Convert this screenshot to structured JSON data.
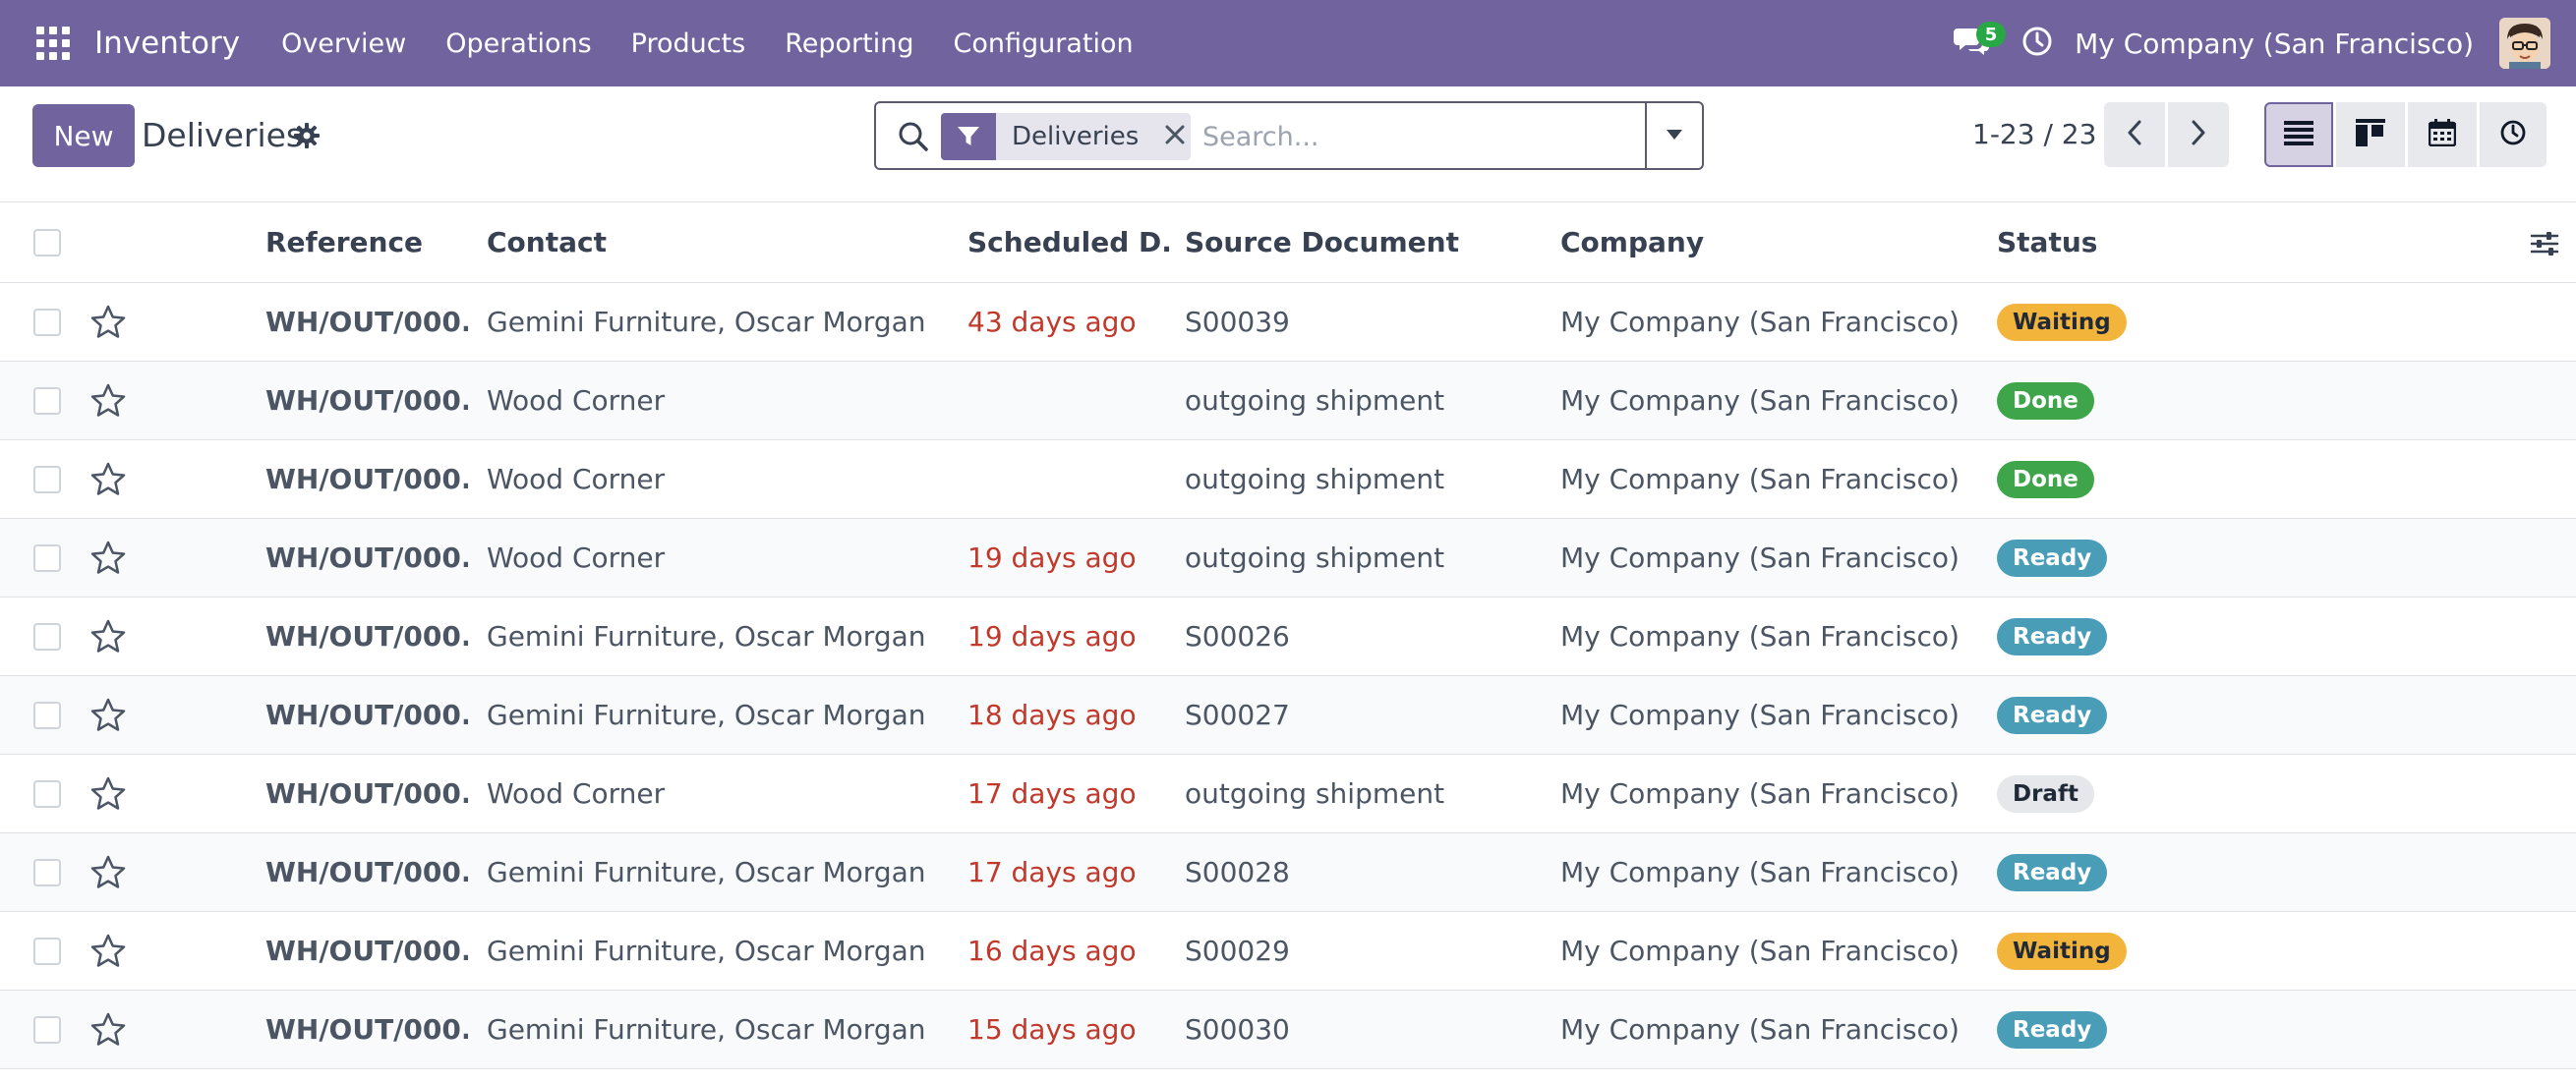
{
  "navbar": {
    "app_name": "Inventory",
    "menu": [
      "Overview",
      "Operations",
      "Products",
      "Reporting",
      "Configuration"
    ],
    "messages_count": "5",
    "company": "My Company (San Francisco)"
  },
  "control_panel": {
    "new_label": "New",
    "title": "Deliveries",
    "search": {
      "facet_label": "Deliveries",
      "placeholder": "Search..."
    },
    "pager": "1-23 / 23"
  },
  "table": {
    "columns": [
      "Reference",
      "Contact",
      "Scheduled D...",
      "Source Document",
      "Company",
      "Status"
    ],
    "rows": [
      {
        "reference": "WH/OUT/000...",
        "contact": "Gemini Furniture, Oscar Morgan",
        "scheduled": "43 days ago",
        "source": "S00039",
        "company": "My Company (San Francisco)",
        "status": "Waiting"
      },
      {
        "reference": "WH/OUT/000...",
        "contact": "Wood Corner",
        "scheduled": "",
        "source": "outgoing shipment",
        "company": "My Company (San Francisco)",
        "status": "Done"
      },
      {
        "reference": "WH/OUT/000...",
        "contact": "Wood Corner",
        "scheduled": "",
        "source": "outgoing shipment",
        "company": "My Company (San Francisco)",
        "status": "Done"
      },
      {
        "reference": "WH/OUT/000...",
        "contact": "Wood Corner",
        "scheduled": "19 days ago",
        "source": "outgoing shipment",
        "company": "My Company (San Francisco)",
        "status": "Ready"
      },
      {
        "reference": "WH/OUT/000...",
        "contact": "Gemini Furniture, Oscar Morgan",
        "scheduled": "19 days ago",
        "source": "S00026",
        "company": "My Company (San Francisco)",
        "status": "Ready"
      },
      {
        "reference": "WH/OUT/000...",
        "contact": "Gemini Furniture, Oscar Morgan",
        "scheduled": "18 days ago",
        "source": "S00027",
        "company": "My Company (San Francisco)",
        "status": "Ready"
      },
      {
        "reference": "WH/OUT/000...",
        "contact": "Wood Corner",
        "scheduled": "17 days ago",
        "source": "outgoing shipment",
        "company": "My Company (San Francisco)",
        "status": "Draft"
      },
      {
        "reference": "WH/OUT/000...",
        "contact": "Gemini Furniture, Oscar Morgan",
        "scheduled": "17 days ago",
        "source": "S00028",
        "company": "My Company (San Francisco)",
        "status": "Ready"
      },
      {
        "reference": "WH/OUT/000...",
        "contact": "Gemini Furniture, Oscar Morgan",
        "scheduled": "16 days ago",
        "source": "S00029",
        "company": "My Company (San Francisco)",
        "status": "Waiting"
      },
      {
        "reference": "WH/OUT/000...",
        "contact": "Gemini Furniture, Oscar Morgan",
        "scheduled": "15 days ago",
        "source": "S00030",
        "company": "My Company (San Francisco)",
        "status": "Ready"
      }
    ]
  },
  "status_colors": {
    "Waiting": {
      "bg": "#f3b43c",
      "fg": "#1f2937"
    },
    "Done": {
      "bg": "#3fa54a",
      "fg": "#ffffff"
    },
    "Ready": {
      "bg": "#4a9db7",
      "fg": "#ffffff"
    },
    "Draft": {
      "bg": "#e5e7eb",
      "fg": "#1f2937"
    }
  },
  "colors": {
    "brand": "#71639e",
    "overdue_date": "#c0392b"
  },
  "icons": {
    "apps": "apps-grid-icon",
    "messages": "chat-bubbles-icon",
    "activity": "clock-icon",
    "settings": "gear-icon",
    "search": "search-icon",
    "filter": "filter-icon",
    "remove": "close-icon",
    "dropdown": "caret-down-icon",
    "prev": "chevron-left-icon",
    "next": "chevron-right-icon",
    "list_view": "list-view-icon",
    "kanban_view": "kanban-view-icon",
    "calendar_view": "calendar-view-icon",
    "activity_view": "clock-view-icon",
    "favorite": "star-icon",
    "optional_columns": "sliders-icon"
  }
}
